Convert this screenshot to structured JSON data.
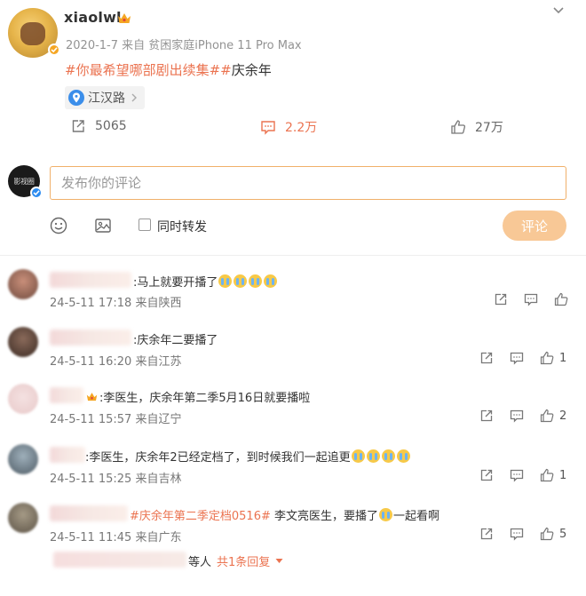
{
  "post": {
    "username": "xiaolwl",
    "date": "2020-1-7",
    "source": "来自 贫困家庭iPhone 11 Pro Max",
    "topic1": "#你最希望哪部剧出续集#",
    "topic2_text": "庆余年",
    "location": "江汉路",
    "reposts": "5065",
    "comments": "2.2万",
    "likes": "27万"
  },
  "composer": {
    "placeholder": "发布你的评论",
    "forward_label": "同时转发",
    "submit_label": "评论"
  },
  "comments": [
    {
      "text": ":马上就要开播了",
      "meta": "24-5-11 17:18 来自陕西",
      "likes": ""
    },
    {
      "text": ":庆余年二要播了",
      "meta": "24-5-11 16:20 来自江苏",
      "likes": "1"
    },
    {
      "text": ":李医生，庆余年第二季5月16日就要播啦",
      "meta": "24-5-11 15:57 来自辽宁",
      "likes": "2"
    },
    {
      "text": ":李医生，庆余年2已经定档了，到时候我们一起追更",
      "meta": "24-5-11 15:25 来自吉林",
      "likes": "1"
    },
    {
      "topic": "#庆余年第二季定档0516#",
      "text_before": " 李文亮医生，要播了",
      "text_after": "一起看啊",
      "meta": "24-5-11 11:45 来自广东",
      "likes": "5"
    }
  ],
  "reply": {
    "by_suffix": "等人",
    "link_label": "共1条回复"
  },
  "colors": {
    "accent": "#eb7350",
    "submit_bg": "#f8c896",
    "input_border": "#f0b06a",
    "verified": "#f5a623"
  }
}
